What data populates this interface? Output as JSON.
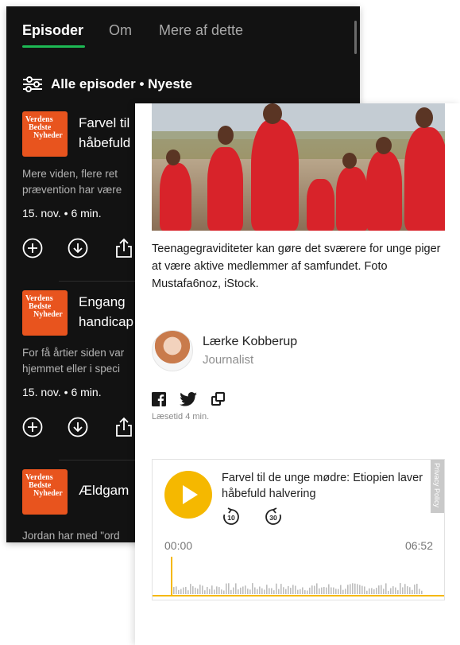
{
  "podcast": {
    "tabs": [
      {
        "label": "Episoder",
        "active": true
      },
      {
        "label": "Om",
        "active": false
      },
      {
        "label": "Mere af dette",
        "active": false
      }
    ],
    "filter_label": "Alle episoder • Nyeste",
    "accent_color": "#1db954",
    "cover_text": [
      "Verdens",
      "Bedste",
      "Nyheder"
    ],
    "episodes": [
      {
        "title": "Farvel til\nhåbefuld",
        "description": "Mere viden, flere ret\nprævention har være",
        "meta": "15. nov. • 6 min."
      },
      {
        "title": "Engang\nhandicap",
        "description": "For få årtier siden var\nhjemmet eller i speci",
        "meta": "15. nov. • 6 min."
      },
      {
        "title": "Ældgam",
        "description": "Jordan har med \"ord",
        "meta": ""
      }
    ],
    "action_icons": [
      "add-circle-icon",
      "download-icon",
      "share-icon"
    ]
  },
  "article": {
    "caption": "Teenagegraviditeter kan gøre det sværere for unge piger at være aktive medlemmer af samfundet. Foto Mustafa6noz, iStock.",
    "author": {
      "name": "Lærke Kobberup",
      "role": "Journalist"
    },
    "share_icons": [
      "facebook-icon",
      "twitter-icon",
      "copy-link-icon"
    ],
    "read_time": "Læsetid 4 min.",
    "player": {
      "title": "Farvel til de unge mødre: Etiopien laver håbefuld halvering",
      "skip_back": "10",
      "skip_forward": "30",
      "privacy_label": "Privacy Policy",
      "time_current": "00:00",
      "time_total": "06:52",
      "progress": 0,
      "accent_color": "#f5b800"
    }
  }
}
